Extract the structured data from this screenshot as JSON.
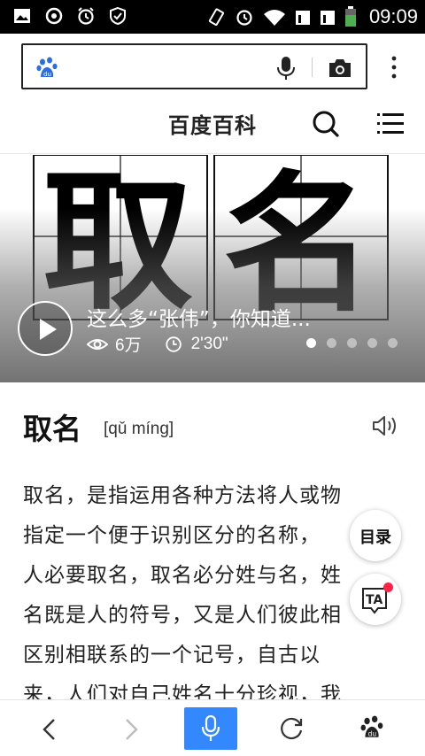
{
  "status_bar": {
    "time": "09:09",
    "left_icons": [
      "gallery-icon",
      "sync-icon",
      "alarm-icon",
      "shield-icon"
    ],
    "right_icons": [
      "vibrate-icon",
      "alarm-icon",
      "wifi-icon",
      "sim1-icon",
      "sim2-icon",
      "battery-icon"
    ],
    "battery_color": "#4caf50"
  },
  "search": {
    "placeholder": "",
    "value": "",
    "brand_color": "#2b6de5"
  },
  "header": {
    "title": "百度百科"
  },
  "video": {
    "title": "这么多“张伟”，你知道...",
    "views": "6万",
    "duration": "2'30\"",
    "slides": 5,
    "active_slide": 0
  },
  "entry": {
    "title": "取名",
    "pinyin": "[qǔ míng]",
    "lines": [
      "取名，是指运用各种方法将人或物",
      "指定一个便于识别区分的名称，",
      "人必要取名，取名必分姓与名，姓",
      "名既是人的符号，又是人们彼此相",
      "区别相联系的一个记号，自古以",
      "来，人们对自己姓名十分珍视，我"
    ]
  },
  "floating": {
    "toc_label": "目录"
  },
  "bottom_nav": {
    "items": [
      "back-icon",
      "forward-icon",
      "voice-icon",
      "refresh-icon",
      "baidu-paw-icon"
    ],
    "accent": "#3388ff"
  }
}
